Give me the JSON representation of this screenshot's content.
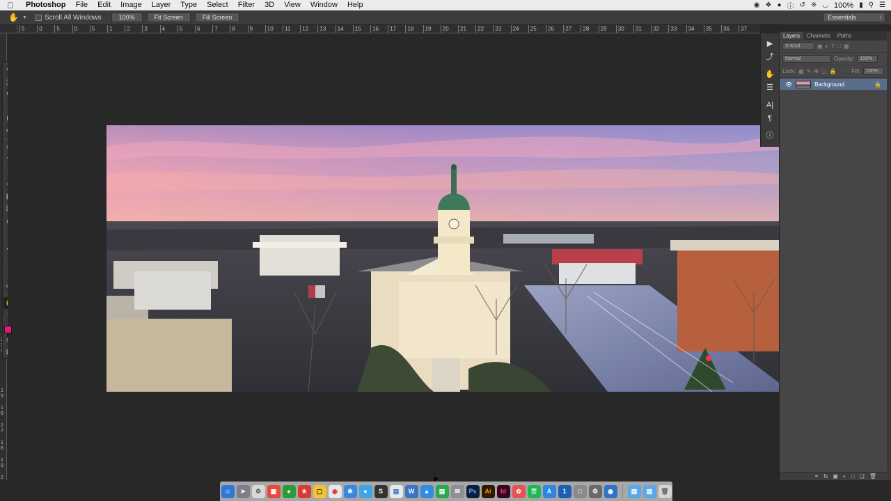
{
  "menubar": {
    "app": "Photoshop",
    "items": [
      "File",
      "Edit",
      "Image",
      "Layer",
      "Type",
      "Select",
      "Filter",
      "3D",
      "View",
      "Window",
      "Help"
    ],
    "battery": "100%"
  },
  "options": {
    "scroll_all_windows": "Scroll All Windows",
    "zoom_button": "100%",
    "fit_screen": "Fit Screen",
    "fill_screen": "Fill Screen",
    "workspace": "Essentials"
  },
  "ruler": {
    "h_ticks": [
      "5",
      "0",
      "5",
      "0",
      "5",
      "1",
      "0",
      "1",
      "5",
      "2",
      "0",
      "2",
      "5",
      "3",
      "0",
      "3",
      "5",
      "4",
      "0",
      "4",
      "5",
      "5",
      "0",
      "5",
      "5",
      "6",
      "0",
      "6",
      "5",
      "7",
      "0",
      "7",
      "5",
      "8",
      "0",
      "8",
      "5",
      "9",
      "0",
      "9",
      "5",
      "10",
      "0",
      "10",
      "5",
      "11",
      "0",
      "11",
      "5",
      "12",
      "0",
      "12",
      "5",
      "13",
      "0",
      "13",
      "5",
      "14",
      "0",
      "14",
      "5",
      "15",
      "0",
      "15",
      "5",
      "16",
      "0",
      "16",
      "5",
      "17",
      "0",
      "17",
      "5",
      "18",
      "0",
      "18",
      "5",
      "19",
      "0",
      "19",
      "5",
      "20",
      "0",
      "20",
      "5",
      "21",
      "0",
      "21",
      "5",
      "22",
      "0",
      "22",
      "5",
      "23",
      "0",
      "23",
      "5",
      "24",
      "0",
      "24",
      "5",
      "25",
      "0",
      "25",
      "5",
      "26",
      "0",
      "26",
      "5",
      "27",
      "0",
      "27",
      "5",
      "28",
      "0",
      "28",
      "5",
      "29",
      "0",
      "29",
      "5",
      "30",
      "0",
      "30",
      "5",
      "31",
      "0",
      "31",
      "5",
      "32",
      "0",
      "32",
      "5",
      "33",
      "0",
      "33",
      "5",
      "34",
      "0",
      "34",
      "5",
      "35",
      "0",
      "35",
      "5",
      "36",
      "0",
      "36",
      "5",
      "37"
    ],
    "v_ticks": [
      "5",
      "5",
      "0",
      "0",
      "5",
      "1",
      "0",
      "1",
      "5",
      "2",
      "0",
      "2",
      "5",
      "3",
      "4",
      "3",
      "3",
      "4",
      "5",
      "4",
      "6",
      "5",
      "7",
      "6",
      "8",
      "7",
      "9",
      "8",
      "0"
    ]
  },
  "layers_panel": {
    "tabs": [
      "Layers",
      "Channels",
      "Paths"
    ],
    "kind": "Kind",
    "blend_mode": "Normal",
    "opacity_label": "Opacity:",
    "opacity_value": "100%",
    "lock_label": "Lock:",
    "fill_label": "Fill:",
    "fill_value": "100%",
    "layer_name": "Background"
  }
}
